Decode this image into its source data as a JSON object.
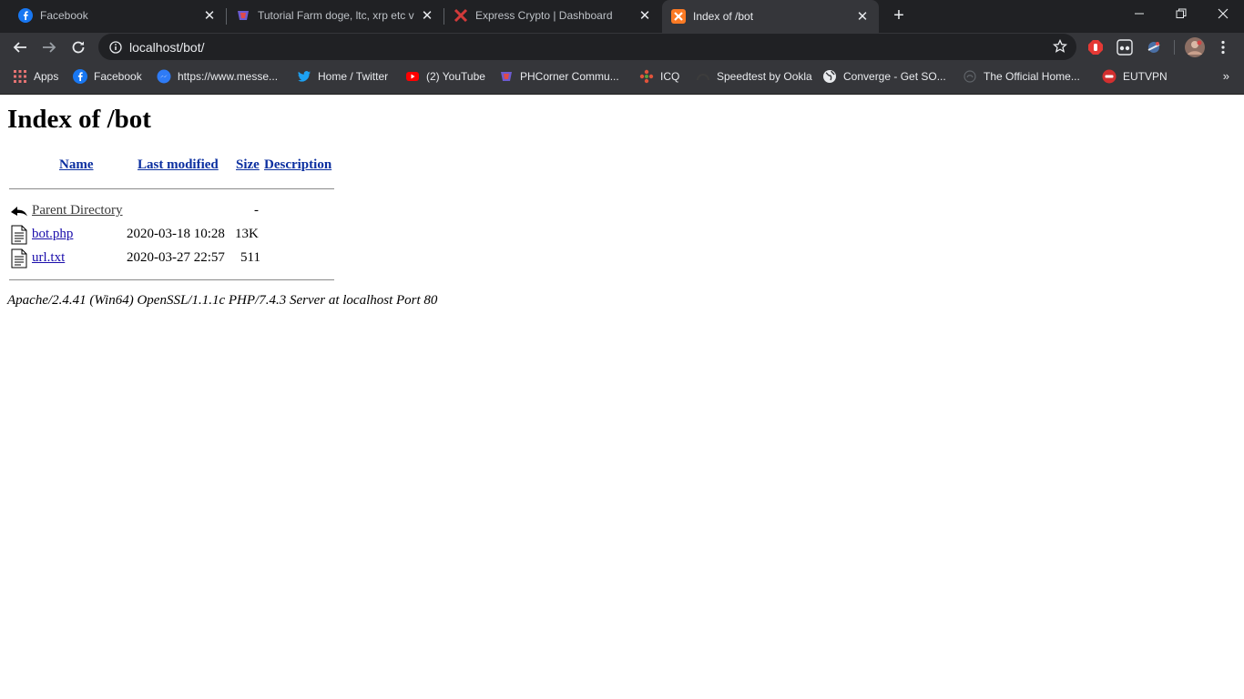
{
  "browser": {
    "tabs": [
      {
        "title": "Facebook"
      },
      {
        "title": "Tutorial Farm doge, ltc, xrp etc v"
      },
      {
        "title": "Express Crypto | Dashboard"
      },
      {
        "title": "Index of /bot"
      }
    ],
    "url": "localhost/bot/",
    "bookmarks": [
      {
        "label": "Apps"
      },
      {
        "label": "Facebook"
      },
      {
        "label": "https://www.messe..."
      },
      {
        "label": "Home / Twitter"
      },
      {
        "label": "(2) YouTube"
      },
      {
        "label": "PHCorner Commu..."
      },
      {
        "label": "ICQ"
      },
      {
        "label": "Speedtest by Ookla"
      },
      {
        "label": "Converge - Get SO..."
      },
      {
        "label": "The Official Home..."
      },
      {
        "label": "EUTVPN"
      }
    ],
    "colors": {
      "chrome_dark": "#202124",
      "toolbar": "#35363a",
      "text": "#e8eaed"
    }
  },
  "page": {
    "title": "Index of /bot",
    "columns": {
      "name": "Name",
      "modified": "Last modified",
      "size": "Size",
      "description": "Description"
    },
    "rows": [
      {
        "name": "Parent Directory",
        "modified": "",
        "size": "-",
        "icon": "back-icon"
      },
      {
        "name": "bot.php",
        "modified": "2020-03-18 10:28",
        "size": "13K",
        "icon": "file-text-icon"
      },
      {
        "name": "url.txt",
        "modified": "2020-03-27 22:57",
        "size": "511",
        "icon": "file-text-icon"
      }
    ],
    "address": "Apache/2.4.41 (Win64) OpenSSL/1.1.1c PHP/7.4.3 Server at localhost Port 80"
  }
}
